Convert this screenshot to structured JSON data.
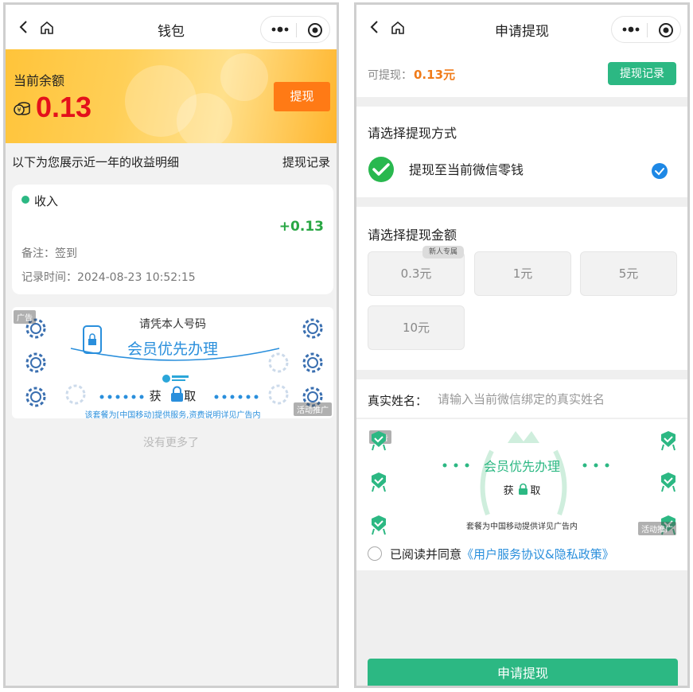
{
  "left": {
    "nav": {
      "title": "钱包"
    },
    "banner": {
      "label": "当前余额",
      "balance": "0.13",
      "withdraw_label": "提现"
    },
    "detail": {
      "text": "以下为您展示近一年的收益明细",
      "record_link": "提现记录"
    },
    "income": {
      "title": "收入",
      "amount": "+0.13",
      "note": "备注：签到",
      "time": "记录时间：2024-08-23 10:52:15"
    },
    "ad": {
      "tag": "广告",
      "line1": "请凭本人号码",
      "line2": "会员优先办理",
      "get_left": "获",
      "get_right": "取",
      "footer": "该套餐为[中国移动]提供服务,资费说明详见广告内",
      "promo_tag": "活动推广"
    },
    "no_more": "没有更多了"
  },
  "right": {
    "nav": {
      "title": "申请提现"
    },
    "available": {
      "label": "可提现：",
      "value": "0.13元",
      "record_button": "提现记录"
    },
    "method": {
      "title": "请选择提现方式",
      "option": "提现至当前微信零钱"
    },
    "amount": {
      "title": "请选择提现金额",
      "new_badge": "新人专属",
      "options": [
        "0.3元",
        "1元",
        "5元",
        "10元"
      ]
    },
    "name": {
      "label": "真实姓名：",
      "placeholder": "请输入当前微信绑定的真实姓名"
    },
    "ad": {
      "tag": "广告",
      "title": "会员优先办理",
      "get_left": "获",
      "get_right": "取",
      "footer": "套餐为中国移动提供详见广告内",
      "promo_tag": "活动推广"
    },
    "agreement": {
      "text": "已阅读并同意",
      "link": "《用户服务协议&隐私政策》"
    },
    "submit_label": "申请提现"
  },
  "colors": {
    "accent_green": "#2cb883",
    "balance_red": "#e4101b",
    "withdraw_orange": "#ff7a15",
    "link_blue": "#2a8fdc",
    "income_green": "#29a744"
  }
}
